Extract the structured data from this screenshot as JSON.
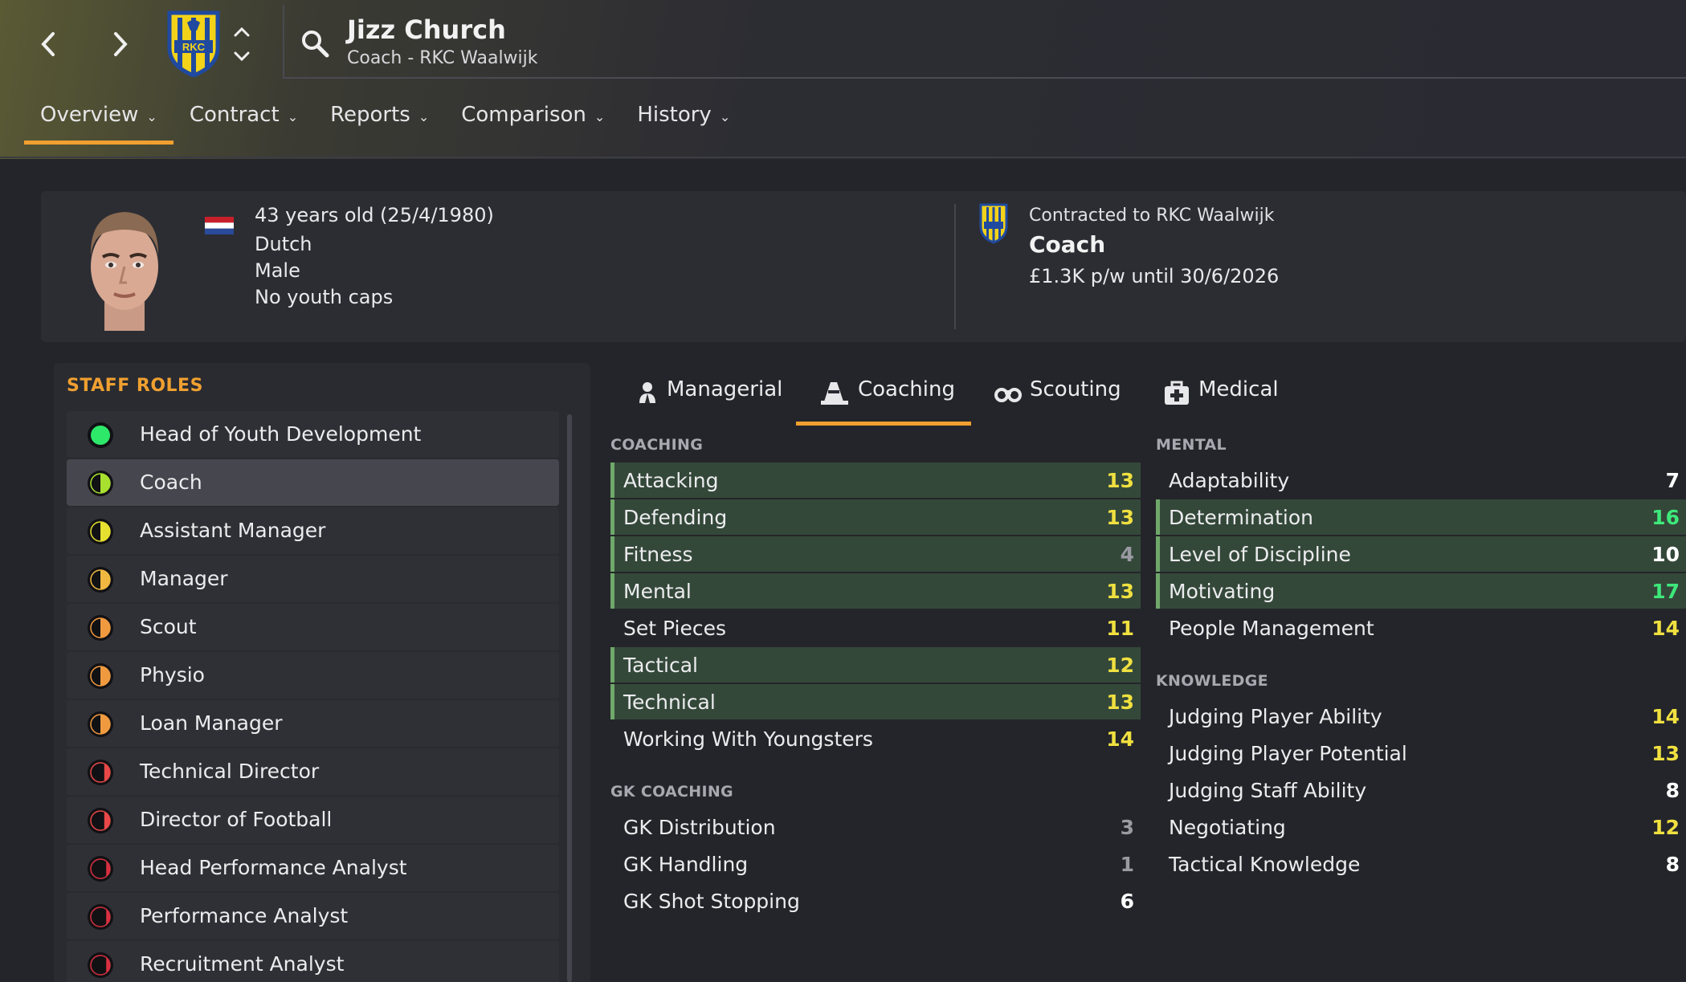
{
  "header": {
    "name": "Jizz Church",
    "subtitle": "Coach - RKC Waalwijk",
    "crest_text": "RKC"
  },
  "tabs": [
    {
      "label": "Overview",
      "active": true
    },
    {
      "label": "Contract"
    },
    {
      "label": "Reports"
    },
    {
      "label": "Comparison"
    },
    {
      "label": "History"
    }
  ],
  "profile": {
    "age": "43 years old (25/4/1980)",
    "nationality": "Dutch",
    "gender": "Male",
    "caps": "No youth caps",
    "contracted_to": "Contracted to RKC Waalwijk",
    "role": "Coach",
    "wage": "£1.3K p/w until 30/6/2026"
  },
  "staff_roles": {
    "title": "STAFF ROLES",
    "items": [
      {
        "label": "Head of Youth Development",
        "color": "#2ee86a",
        "fill": 1.0
      },
      {
        "label": "Coach",
        "color": "#a8e030",
        "fill": 0.5,
        "selected": true
      },
      {
        "label": "Assistant Manager",
        "color": "#e6e030",
        "fill": 0.5
      },
      {
        "label": "Manager",
        "color": "#f0b840",
        "fill": 0.5
      },
      {
        "label": "Scout",
        "color": "#f09a40",
        "fill": 0.5
      },
      {
        "label": "Physio",
        "color": "#f09a40",
        "fill": 0.5
      },
      {
        "label": "Loan Manager",
        "color": "#f09a40",
        "fill": 0.5
      },
      {
        "label": "Technical Director",
        "color": "#e84848",
        "fill": 0.3
      },
      {
        "label": "Director of Football",
        "color": "#e84848",
        "fill": 0.3
      },
      {
        "label": "Head Performance Analyst",
        "color": "#d83040",
        "fill": 0.2
      },
      {
        "label": "Performance Analyst",
        "color": "#d83040",
        "fill": 0.2
      },
      {
        "label": "Recruitment Analyst",
        "color": "#d83040",
        "fill": 0.2
      }
    ]
  },
  "attr_tabs": [
    {
      "label": "Managerial",
      "icon": "managerial-icon"
    },
    {
      "label": "Coaching",
      "icon": "cone-icon",
      "active": true
    },
    {
      "label": "Scouting",
      "icon": "binoculars-icon"
    },
    {
      "label": "Medical",
      "icon": "medical-kit-icon"
    }
  ],
  "coaching": {
    "title": "COACHING",
    "items": [
      {
        "name": "Attacking",
        "value": "13",
        "hl": true,
        "color": "yellow"
      },
      {
        "name": "Defending",
        "value": "13",
        "hl": true,
        "color": "yellow"
      },
      {
        "name": "Fitness",
        "value": "4",
        "hl": true,
        "color": "grey"
      },
      {
        "name": "Mental",
        "value": "13",
        "hl": true,
        "color": "yellow"
      },
      {
        "name": "Set Pieces",
        "value": "11",
        "hl": false,
        "color": "yellow"
      },
      {
        "name": "Tactical",
        "value": "12",
        "hl": true,
        "color": "yellow"
      },
      {
        "name": "Technical",
        "value": "13",
        "hl": true,
        "color": "yellow"
      },
      {
        "name": "Working With Youngsters",
        "value": "14",
        "hl": false,
        "color": "yellow"
      }
    ]
  },
  "gk_coaching": {
    "title": "GK COACHING",
    "items": [
      {
        "name": "GK Distribution",
        "value": "3",
        "color": "grey"
      },
      {
        "name": "GK Handling",
        "value": "1",
        "color": "grey"
      },
      {
        "name": "GK Shot Stopping",
        "value": "6",
        "color": "white"
      }
    ]
  },
  "mental": {
    "title": "MENTAL",
    "items": [
      {
        "name": "Adaptability",
        "value": "7",
        "hl": false,
        "color": "white"
      },
      {
        "name": "Determination",
        "value": "16",
        "hl": true,
        "color": "green"
      },
      {
        "name": "Level of Discipline",
        "value": "10",
        "hl": true,
        "color": "white"
      },
      {
        "name": "Motivating",
        "value": "17",
        "hl": true,
        "color": "green"
      },
      {
        "name": "People Management",
        "value": "14",
        "hl": false,
        "color": "yellow"
      }
    ]
  },
  "knowledge": {
    "title": "KNOWLEDGE",
    "items": [
      {
        "name": "Judging Player Ability",
        "value": "14",
        "color": "yellow"
      },
      {
        "name": "Judging Player Potential",
        "value": "13",
        "color": "yellow"
      },
      {
        "name": "Judging Staff Ability",
        "value": "8",
        "color": "white"
      },
      {
        "name": "Negotiating",
        "value": "12",
        "color": "yellow"
      },
      {
        "name": "Tactical Knowledge",
        "value": "8",
        "color": "white"
      }
    ]
  }
}
